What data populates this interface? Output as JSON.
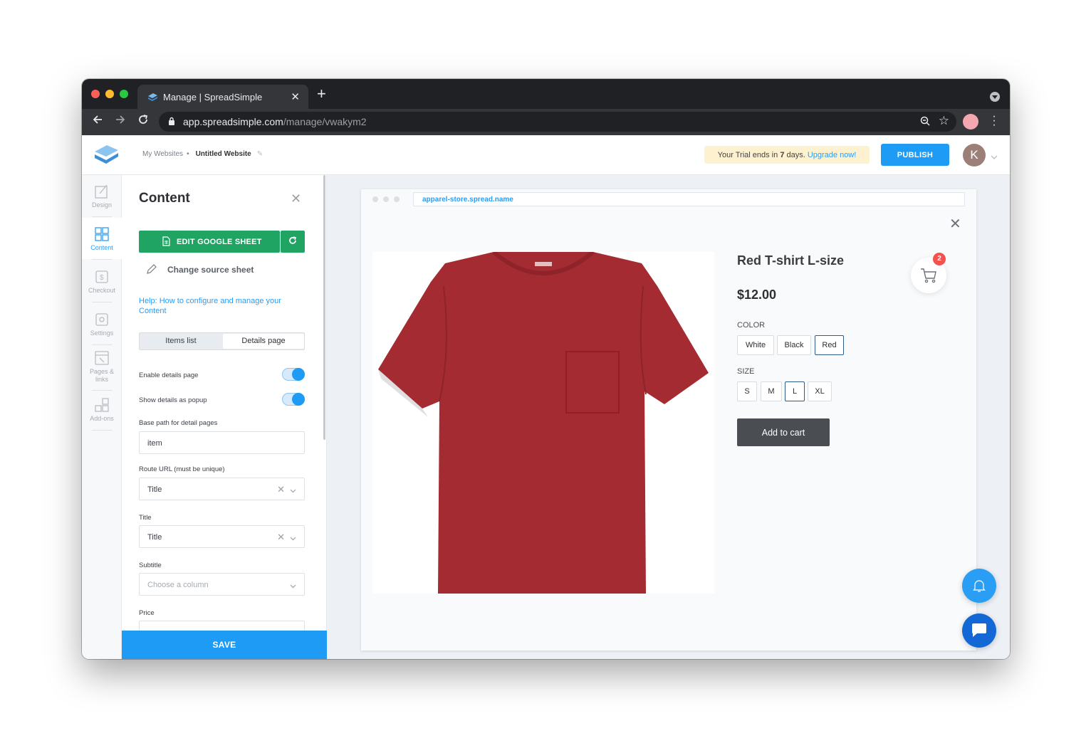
{
  "browser": {
    "tab_title": "Manage | SpreadSimple",
    "url_host": "app.spreadsimple.com",
    "url_path": "/manage/vwakym2"
  },
  "header": {
    "breadcrumb_root": "My Websites",
    "breadcrumb_current": "Untitled Website",
    "trial_prefix": "Your Trial ends in ",
    "trial_days": "7",
    "trial_suffix": " days. ",
    "trial_upgrade": "Upgrade now!",
    "publish_label": "PUBLISH",
    "avatar_initial": "K"
  },
  "rail": {
    "items": [
      {
        "label": "Design"
      },
      {
        "label": "Content"
      },
      {
        "label": "Checkout"
      },
      {
        "label": "Settings"
      },
      {
        "label": "Pages &"
      },
      {
        "label": "links"
      },
      {
        "label": "Add-ons"
      }
    ]
  },
  "panel": {
    "title": "Content",
    "edit_sheet_label": "EDIT GOOGLE SHEET",
    "change_source_label": "Change source sheet",
    "help_text": "Help: How to configure and manage your Content",
    "tab_items_list": "Items list",
    "tab_details_page": "Details page",
    "enable_details_label": "Enable details page",
    "enable_details_on": true,
    "popup_label": "Show details as popup",
    "popup_on": true,
    "base_path_label": "Base path for detail pages",
    "base_path_value": "item",
    "route_label": "Route URL (must be unique)",
    "route_value": "Title",
    "title_label": "Title",
    "title_value": "Title",
    "subtitle_label": "Subtitle",
    "subtitle_placeholder": "Choose a column",
    "price_label": "Price",
    "save_label": "SAVE"
  },
  "preview": {
    "site_url": "apparel-store.spread.name",
    "product_title": "Red T-shirt L-size",
    "product_price": "$12.00",
    "color_label": "COLOR",
    "colors": [
      "White",
      "Black",
      "Red"
    ],
    "selected_color": "Red",
    "size_label": "SIZE",
    "sizes": [
      "S",
      "M",
      "L",
      "XL"
    ],
    "selected_size": "L",
    "add_to_cart_label": "Add to cart",
    "cart_count": "2",
    "colors_hex": {
      "accent": "#1e9cf5",
      "sheet_green": "#1fa463",
      "shirt_red": "#a42b32",
      "badge_red": "#f5514f"
    }
  }
}
